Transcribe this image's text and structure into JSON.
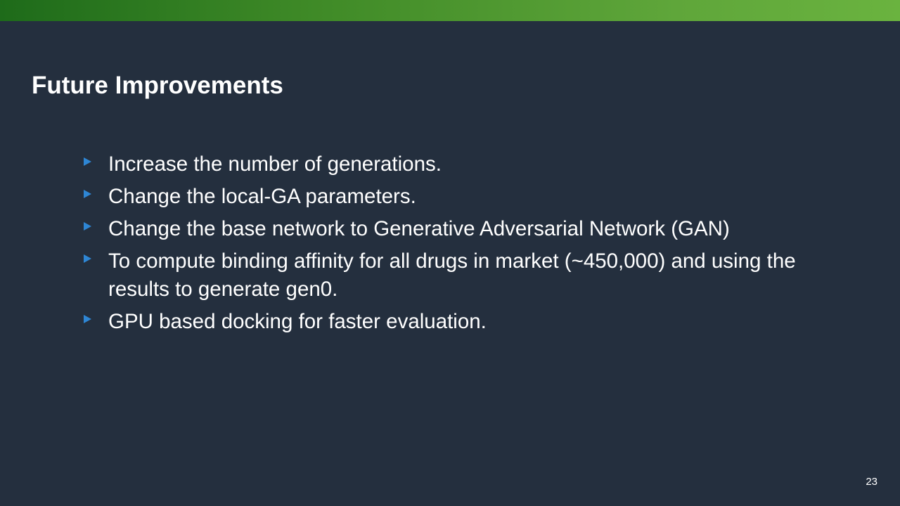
{
  "slide": {
    "title": "Future Improvements",
    "page_number": "23",
    "colors": {
      "background": "#242f3e",
      "accent_bar_start": "#1e6b1a",
      "accent_bar_end": "#6ab33f",
      "bullet_marker": "#2e86d4",
      "text": "#ffffff"
    },
    "bullets": [
      {
        "icon": "triangle-right-bullet-icon",
        "text": "Increase the number of generations."
      },
      {
        "icon": "triangle-right-bullet-icon",
        "text": "Change the local-GA parameters."
      },
      {
        "icon": "triangle-right-bullet-icon",
        "text": "Change the base network to Generative Adversarial Network (GAN)"
      },
      {
        "icon": "triangle-right-bullet-icon",
        "text": "To compute binding affinity for all drugs in market (~450,000) and using the results to generate gen0."
      },
      {
        "icon": "triangle-right-bullet-icon",
        "text": "GPU based docking for faster evaluation."
      }
    ]
  }
}
